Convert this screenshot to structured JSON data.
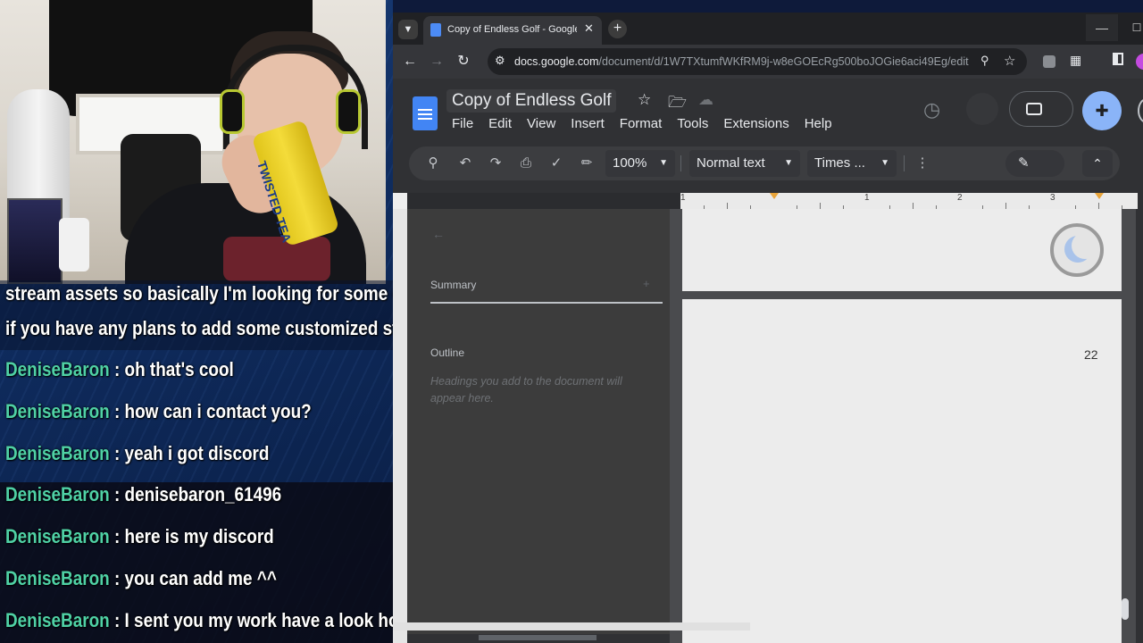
{
  "stream": {
    "can_text": "TWISTED TEA",
    "chat": [
      {
        "name": "",
        "sep": "",
        "text": "stream assets so basically I'm looking for some com"
      },
      {
        "name": "",
        "sep": "",
        "text": "if you have any plans to add some customized stuff f"
      },
      {
        "name": "DeniseBaron",
        "sep": " : ",
        "text": "oh that's cool"
      },
      {
        "name": "DeniseBaron",
        "sep": " : ",
        "text": "how can i contact you?"
      },
      {
        "name": "DeniseBaron",
        "sep": " : ",
        "text": "yeah i got discord"
      },
      {
        "name": "DeniseBaron",
        "sep": " : ",
        "text": "denisebaron_61496"
      },
      {
        "name": "DeniseBaron",
        "sep": " : ",
        "text": "here is my discord"
      },
      {
        "name": "DeniseBaron",
        "sep": " : ",
        "text": "you can add me ^^"
      },
      {
        "name": "DeniseBaron",
        "sep": " : ",
        "text": "I sent you my work have a look homie"
      }
    ],
    "colors": {
      "username": "#4fd1a5"
    }
  },
  "browser": {
    "tab_title": "Copy of Endless Golf - Google Docs",
    "url_domain": "docs.google.com",
    "url_path": "/document/d/1W7TXtumfWKfRM9j-w8eGOEcRg500boJOGie6aci49Eg/edit",
    "icons": [
      "tab-search-icon",
      "close-icon",
      "plus-icon",
      "back-arrow-icon",
      "forward-arrow-icon",
      "reload-icon",
      "site-info-icon",
      "zoom-icon",
      "star-icon",
      "extensions-icon",
      "side-panel-icon"
    ]
  },
  "docs": {
    "title": "Copy of Endless Golf",
    "menu": [
      "File",
      "Edit",
      "View",
      "Insert",
      "Format",
      "Tools",
      "Extensions",
      "Help"
    ],
    "toolbar": {
      "zoom": "100%",
      "style": "Normal text",
      "font": "Times ..."
    },
    "ruler_numbers": [
      "1",
      "1",
      "2",
      "3"
    ],
    "outline": {
      "summary_label": "Summary",
      "outline_label": "Outline",
      "hint": "Headings you add to the document will appear here."
    },
    "page_number": "22",
    "colors": {
      "accent": "#8ab4f8",
      "docs_blue": "#4285f4",
      "ruler_marker": "#e8a43a"
    }
  }
}
